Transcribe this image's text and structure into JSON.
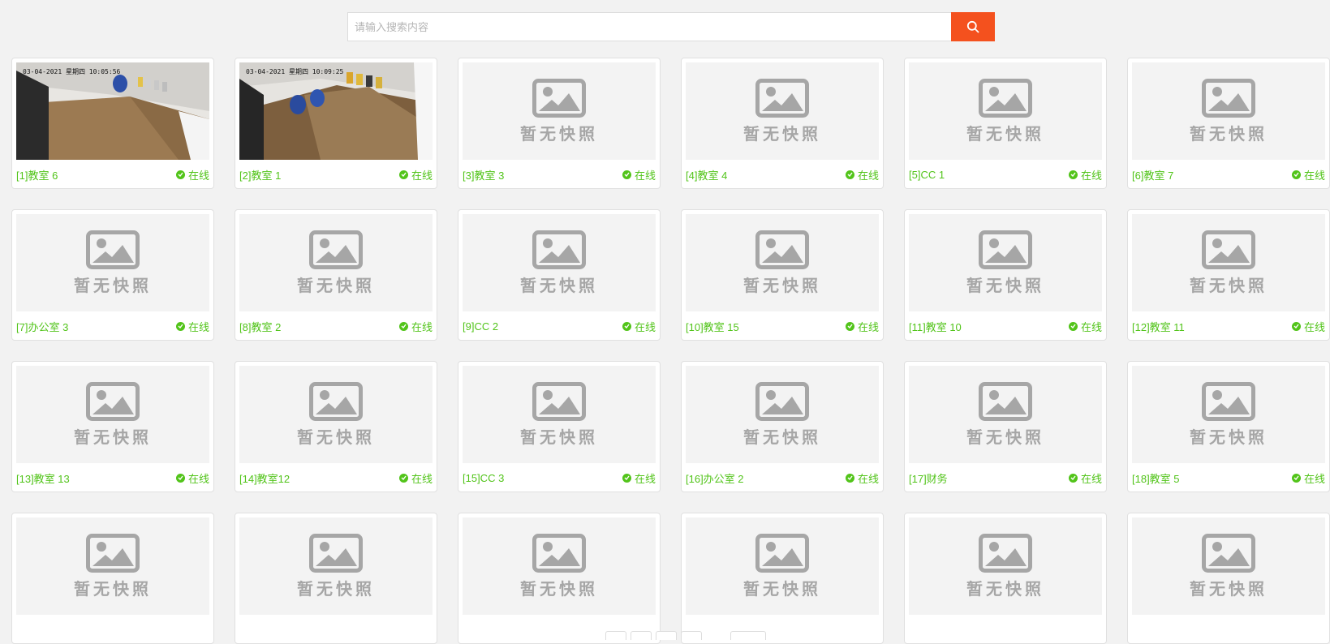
{
  "search": {
    "placeholder": "请输入搜索内容",
    "value": "",
    "button_icon": "search-icon",
    "button_color": "#f4511e"
  },
  "no_snapshot_label": "暂无快照",
  "status_color": "#52c41a",
  "snapshots": [
    {
      "timestamp": "03-04-2021 星期四 10:05:56"
    },
    {
      "timestamp": "03-04-2021 星期四 10:09:25"
    }
  ],
  "cameras": [
    {
      "name": "[1]教室 6",
      "status": "在线",
      "has_snapshot": true
    },
    {
      "name": "[2]教室 1",
      "status": "在线",
      "has_snapshot": true
    },
    {
      "name": "[3]教室 3",
      "status": "在线",
      "has_snapshot": false
    },
    {
      "name": "[4]教室 4",
      "status": "在线",
      "has_snapshot": false
    },
    {
      "name": "[5]CC 1",
      "status": "在线",
      "has_snapshot": false
    },
    {
      "name": "[6]教室 7",
      "status": "在线",
      "has_snapshot": false
    },
    {
      "name": "[7]办公室 3",
      "status": "在线",
      "has_snapshot": false
    },
    {
      "name": "[8]教室 2",
      "status": "在线",
      "has_snapshot": false
    },
    {
      "name": "[9]CC 2",
      "status": "在线",
      "has_snapshot": false
    },
    {
      "name": "[10]教室 15",
      "status": "在线",
      "has_snapshot": false
    },
    {
      "name": "[11]教室 10",
      "status": "在线",
      "has_snapshot": false
    },
    {
      "name": "[12]教室 11",
      "status": "在线",
      "has_snapshot": false
    },
    {
      "name": "[13]教室 13",
      "status": "在线",
      "has_snapshot": false
    },
    {
      "name": "[14]教室12",
      "status": "在线",
      "has_snapshot": false
    },
    {
      "name": "[15]CC 3",
      "status": "在线",
      "has_snapshot": false
    },
    {
      "name": "[16]办公室 2",
      "status": "在线",
      "has_snapshot": false
    },
    {
      "name": "[17]财务",
      "status": "在线",
      "has_snapshot": false
    },
    {
      "name": "[18]教室 5",
      "status": "在线",
      "has_snapshot": false
    },
    {
      "name": "",
      "status": "",
      "has_snapshot": false
    },
    {
      "name": "",
      "status": "",
      "has_snapshot": false
    },
    {
      "name": "",
      "status": "",
      "has_snapshot": false
    },
    {
      "name": "",
      "status": "",
      "has_snapshot": false
    },
    {
      "name": "",
      "status": "",
      "has_snapshot": false
    },
    {
      "name": "",
      "status": "",
      "has_snapshot": false
    }
  ]
}
